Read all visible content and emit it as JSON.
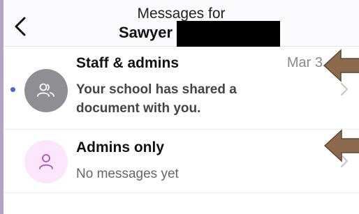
{
  "header": {
    "title": "Messages for",
    "name": "Sawyer"
  },
  "conversations": [
    {
      "title": "Staff & admins",
      "date": "Mar 3",
      "preview": "Your school has shared a document with you.",
      "unread": true,
      "icon": "group-icon"
    },
    {
      "title": "Admins only",
      "preview": "No messages yet",
      "unread": false,
      "icon": "person-icon"
    }
  ],
  "colors": {
    "unread_dot": "#4a63d8",
    "annotation_arrow": "#8b6a4e",
    "admins_avatar_bg": "#fbe6fb",
    "admins_avatar_icon": "#b04cc6",
    "staff_avatar_bg": "#8e8e93"
  }
}
